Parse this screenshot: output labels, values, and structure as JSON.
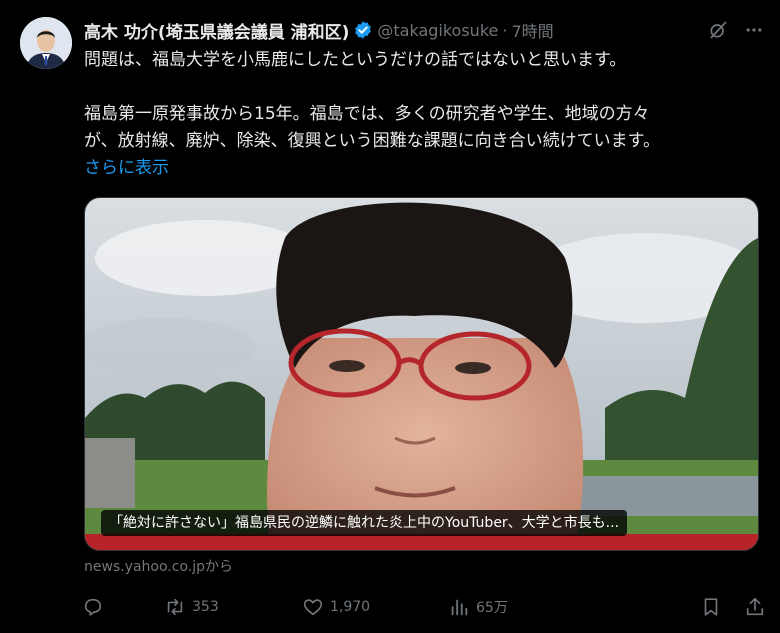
{
  "author": {
    "name": "高木 功介(埼玉県議会議員 浦和区)",
    "handle": "@takagikosuke",
    "separator": "·",
    "time": "7時間"
  },
  "tweet": {
    "paragraph1": "問題は、福島大学を小馬鹿にしたというだけの話ではないと思います。",
    "paragraph2_line1": "福島第一原発事故から15年。福島では、多くの研究者や学生、地域の方々",
    "paragraph2_line2": "が、放射線、廃炉、除染、復興という困難な課題に向き合い続けています。",
    "show_more": "さらに表示"
  },
  "card": {
    "caption": "「絶対に許さない」福島県民の逆鱗に触れた炎上中のYouTuber、大学と市長も...",
    "source": "news.yahoo.co.jpから"
  },
  "actions": {
    "reply_icon": "reply-icon",
    "retweet_icon": "retweet-icon",
    "retweet_count": "353",
    "like_icon": "heart-icon",
    "like_count": "1,970",
    "views_icon": "views-icon",
    "views_count": "65万",
    "bookmark_icon": "bookmark-icon",
    "share_icon": "share-icon"
  },
  "colors": {
    "background": "#000000",
    "text": "#e7e9ea",
    "muted": "#71767b",
    "link": "#1d9bf0",
    "verified": "#1d9bf0"
  }
}
